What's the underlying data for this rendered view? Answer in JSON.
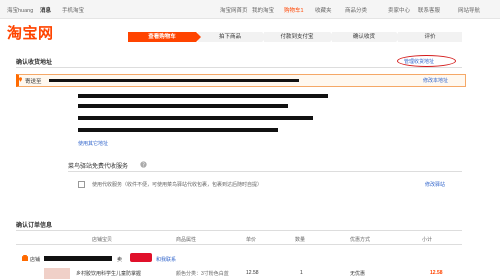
{
  "topbar": {
    "user": "海宝huang",
    "messages": "消息",
    "mobile": "手机淘宝",
    "home": "淘宝网首页",
    "my_taobao": "我的淘宝",
    "cart": "购物车1",
    "favorites": "收藏夹",
    "categories": "商品分类",
    "seller_center": "卖家中心",
    "service": "联系客服",
    "site_nav": "网站导航"
  },
  "logo": "淘宝网",
  "steps": [
    "查看购物车",
    "拍下商品",
    "付款到支付宝",
    "确认收货",
    "评价"
  ],
  "address_section": {
    "title": "确认收货地址",
    "manage_link": "管理收货地址",
    "send_to": "寄送至",
    "modify_link": "修改本地址",
    "use_other": "使用其它地址"
  },
  "cainiao": {
    "title": "菜鸟驿站免费代收服务",
    "help_icon": "question-icon",
    "option_text": "使用代收服务（收件不便，可使用菜鸟驿站代收包裹，包裹到达后随时自提）",
    "modify_link": "修改驿站"
  },
  "order_section": {
    "title": "确认订单信息",
    "columns": [
      "店铺宝贝",
      "商品属性",
      "单价",
      "数量",
      "优惠方式",
      "小计"
    ],
    "shop_label": "店铺",
    "shop_name": "卖",
    "shop_contact": "和我联系",
    "item": {
      "title": "乡村胶饮用科学生儿童防掌握",
      "attrs": "颜色分类：3寸粉色白蓝",
      "price": "12.58",
      "qty": "1",
      "discount": "无优惠",
      "subtotal": "12.58"
    }
  },
  "colors": {
    "accent": "#ff4400",
    "link": "#3366cc"
  }
}
